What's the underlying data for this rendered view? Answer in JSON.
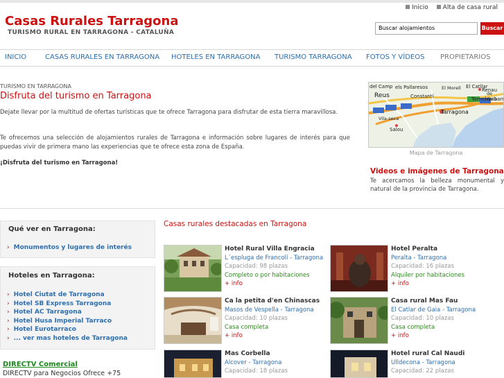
{
  "top_links": [
    {
      "label": "Inicio"
    },
    {
      "label": "Alta de casa rural"
    }
  ],
  "header": {
    "logo": "Casas Rurales Tarragona",
    "tagline": "TURISMO RURAL EN TARRAGONA - CATALUÑA",
    "search_value": "Buscar alojamientos",
    "search_button": "Buscar"
  },
  "nav": [
    {
      "label": "INICIO"
    },
    {
      "label": "CASAS RURALES EN TARRAGONA"
    },
    {
      "label": "HOTELES EN TARRAGONA"
    },
    {
      "label": "TURISMO TARRAGONA"
    },
    {
      "label": "FOTOS Y VÍDEOS"
    },
    {
      "label": "PROPIETARIOS"
    }
  ],
  "main": {
    "breadcrumb": "TURISMO EN TARRAGONA",
    "title": "Disfruta del turismo en Tarragona",
    "paragraphs": [
      "Dejate llevar por la multitud de ofertas turísticas que te ofrece Tarragona para disfrutar de esta tierra maravillosa.",
      "Te ofrecemos una selección de alojamientos rurales de Tarragona e información sobre lugares de interés para que puedas vivir de primera mano las experiencias que te ofrece esta zona de España.",
      "¡Disfruta del turismo en Tarragona!"
    ]
  },
  "map": {
    "caption": "Mapa de Tarragona",
    "labels": [
      "del Camp",
      "els Pallaresos",
      "El Catllar",
      "Reus",
      "Constantí",
      "Renau",
      "Tarragona",
      "Vila-seca",
      "Salou",
      "Torredembarra",
      "de Gaià",
      "El Morell"
    ]
  },
  "sidebar_right": {
    "title": "Videos e imágenes de Tarragona",
    "text": "Te acercamos la belleza monumental y natural de la provincia de Tarragona."
  },
  "left_boxes": [
    {
      "title": "Qué ver en Tarragona:",
      "items": [
        "Monumentos y lugares de interés"
      ]
    },
    {
      "title": "Hoteles en Tarragona:",
      "items": [
        "Hotel Ciutat de Tarragona",
        "Hotel SB Express Tarragona",
        "Hotel AC Tarragona",
        "Hotel Husa Imperial Tarraco",
        "Hotel Eurotarraco",
        "... ver mas hoteles de Tarragona"
      ]
    }
  ],
  "ad": {
    "title": "DIRECTV Comercial",
    "text": "DIRECTV para Negocios Ofrece +75"
  },
  "featured": {
    "title": "Casas rurales destacadas en Tarragona",
    "cards": [
      {
        "name": "Hotel Rural Villa Engracia",
        "location": "L´espluga de Francolí - Tarragona",
        "capacity": "Capacidad: 98 plazas",
        "type": "Completo o por habitaciones",
        "more": "+ info"
      },
      {
        "name": "Hotel Peralta",
        "location": "Peralta - Tarragona",
        "capacity": "Capacidad: 16 plazas",
        "type": "Alquiler por habitaciones",
        "more": "+ info"
      },
      {
        "name": "Ca la petita d'en Chinascas",
        "location": "Masos de Vespella - Tarragona",
        "capacity": "Capacidad: 10 plazas",
        "type": "Casa completa",
        "more": "+ info"
      },
      {
        "name": "Casa rural Mas Fau",
        "location": "El Catlar de Gaia - Tarragona",
        "capacity": "Capacidad: 10 plazas",
        "type": "Casa completa",
        "more": "+ info"
      },
      {
        "name": "Mas Corbella",
        "location": "Alcover - Tarragona",
        "capacity": "Capacidad: 18 plazas",
        "type": "",
        "more": ""
      },
      {
        "name": "Hotel rural Cal Naudi",
        "location": "Ulldecona - Tarragona",
        "capacity": "Capacidad: 22 plazas",
        "type": "",
        "more": ""
      }
    ]
  },
  "colors": {
    "brand_red": "#cc1111",
    "link_blue": "#2d6fb0",
    "green": "#2e8b1e"
  }
}
